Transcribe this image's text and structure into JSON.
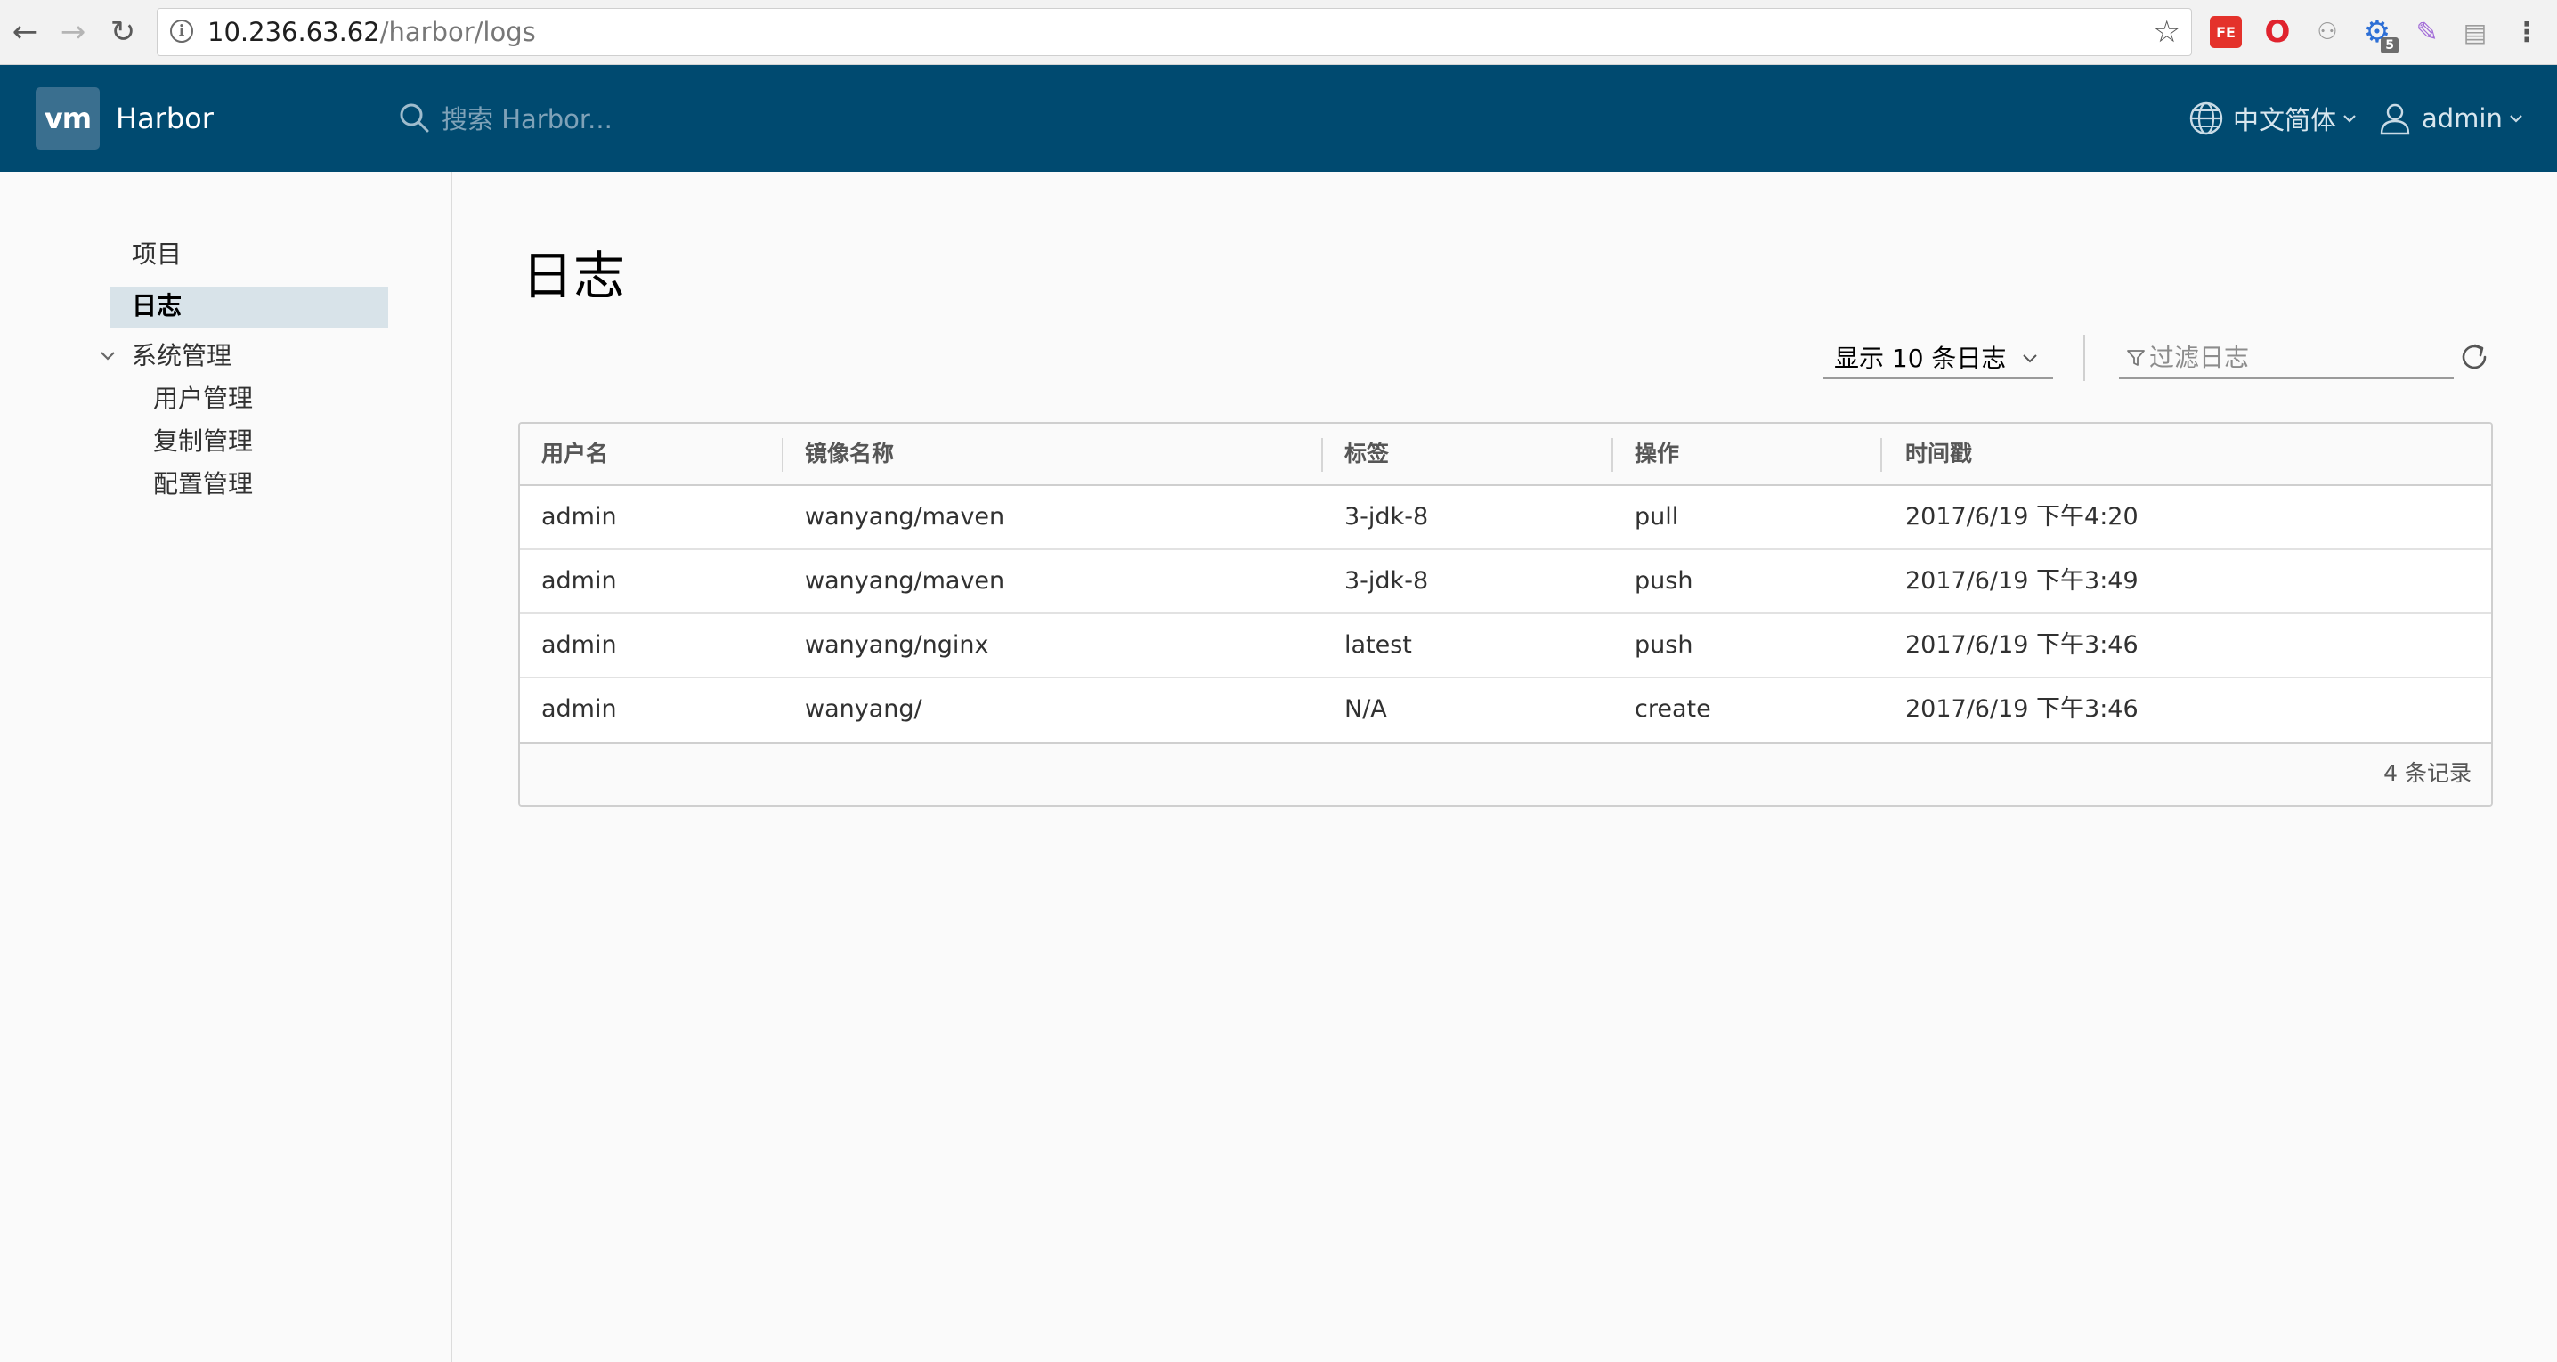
{
  "browser": {
    "back_icon": "←",
    "forward_icon": "→",
    "reload_icon": "↻",
    "url_host": "10.236.63.62",
    "url_path": "/harbor/logs",
    "star_icon": "☆",
    "extensions": {
      "fe_label": "FE",
      "opera_glyph": "O",
      "tree_glyph": "⚇",
      "gear_glyph": "⚙",
      "gear_badge": "5",
      "pen_glyph": "✎",
      "layout_glyph": "▤",
      "menu_glyph": "⋮"
    }
  },
  "header": {
    "logo_text": "vm",
    "brand": "Harbor",
    "search_placeholder": "搜索 Harbor...",
    "language": "中文简体",
    "user": "admin",
    "bg_color": "#004a70"
  },
  "sidebar": {
    "items": [
      {
        "label": "项目"
      },
      {
        "label": "日志"
      },
      {
        "label": "系统管理"
      },
      {
        "label": "用户管理"
      },
      {
        "label": "复制管理"
      },
      {
        "label": "配置管理"
      }
    ]
  },
  "main": {
    "title": "日志",
    "page_size_label": "显示 10 条日志",
    "filter_placeholder": "过滤日志",
    "columns": [
      "用户名",
      "镜像名称",
      "标签",
      "操作",
      "时间戳"
    ],
    "rows": [
      {
        "user": "admin",
        "repo": "wanyang/maven",
        "tag": "3-jdk-8",
        "op": "pull",
        "time": "2017/6/19 下午4:20"
      },
      {
        "user": "admin",
        "repo": "wanyang/maven",
        "tag": "3-jdk-8",
        "op": "push",
        "time": "2017/6/19 下午3:49"
      },
      {
        "user": "admin",
        "repo": "wanyang/nginx",
        "tag": "latest",
        "op": "push",
        "time": "2017/6/19 下午3:46"
      },
      {
        "user": "admin",
        "repo": "wanyang/",
        "tag": "N/A",
        "op": "create",
        "time": "2017/6/19 下午3:46"
      }
    ],
    "footer_count": "4 条记录"
  }
}
